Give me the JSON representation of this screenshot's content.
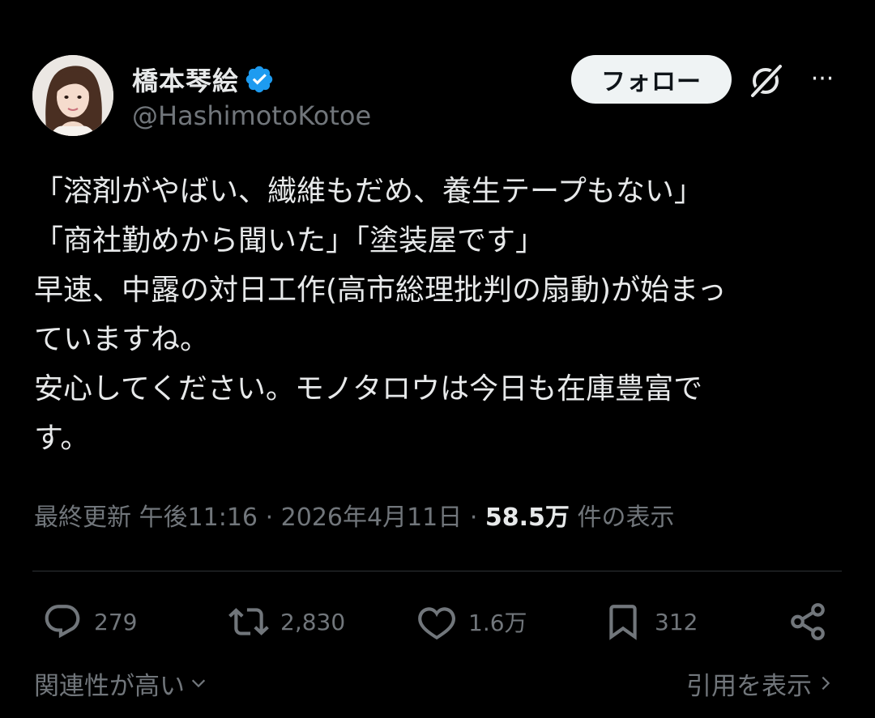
{
  "author": {
    "display_name": "橋本琴絵",
    "handle": "@HashimotoKotoe",
    "avatar_icon": "profile-photo",
    "verified_icon": "verified-badge-icon",
    "verified_color": "#1d9bf0"
  },
  "header": {
    "follow_label": "フォロー",
    "grok_icon": "grok-icon",
    "more_icon": "more-options-icon",
    "more_glyph": "···"
  },
  "tweet": {
    "lines": [
      "「溶剤がやばい、繊維もだめ、養生テープもない」",
      "「商社勤めから聞いた」「塗装屋です」",
      "早速、中露の対日工作(高市総理批判の扇動)が始まっ",
      "ていますね。",
      "安心してください。モノタロウは今日も在庫豊富で",
      "す。"
    ]
  },
  "meta": {
    "updated_label": "最終更新",
    "time": "午後11:16",
    "separator": "·",
    "date": "2026年4月11日",
    "views_count": "58.5万",
    "views_label": "件の表示"
  },
  "actions": {
    "reply": {
      "icon": "reply-icon",
      "count": "279"
    },
    "repost": {
      "icon": "repost-icon",
      "count": "2,830"
    },
    "like": {
      "icon": "heart-icon",
      "count": "1.6万"
    },
    "bookmark": {
      "icon": "bookmark-icon",
      "count": "312"
    },
    "share": {
      "icon": "share-icon"
    }
  },
  "footer": {
    "sort_label": "関連性が高い",
    "quotes_label": "引用を表示"
  },
  "colors": {
    "background": "#000000",
    "text_primary": "#e7e9ea",
    "text_secondary": "#71767b",
    "divider": "#2f3336",
    "follow_bg": "#eff3f4"
  }
}
